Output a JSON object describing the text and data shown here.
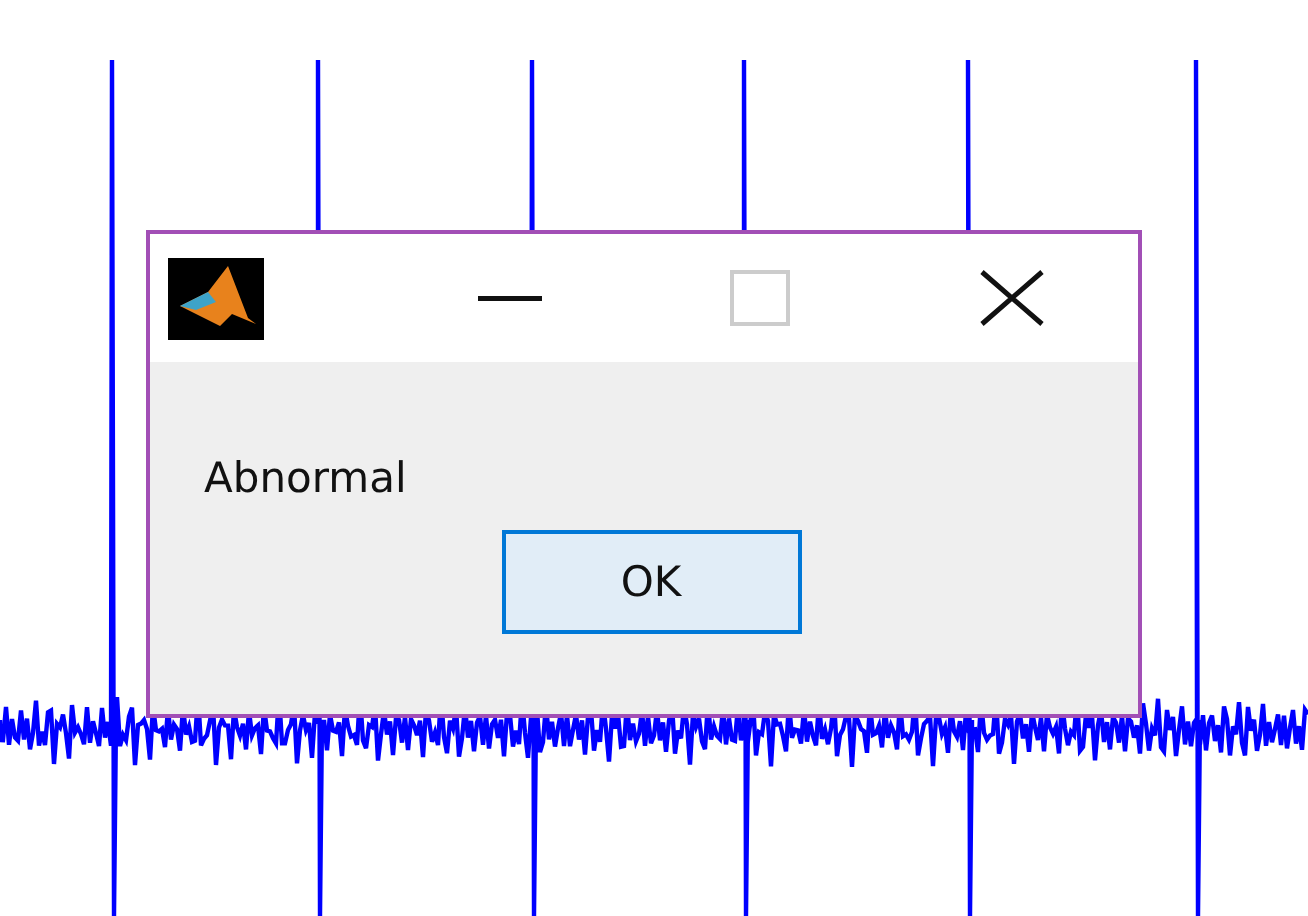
{
  "dialog": {
    "controls": [
      {
        "kind": "minimize",
        "disabled": false
      },
      {
        "kind": "maximize",
        "disabled": true
      },
      {
        "kind": "close",
        "disabled": false
      }
    ],
    "message": "Abnormal",
    "buttons": [
      {
        "label": "OK",
        "focused": true
      }
    ]
  }
}
